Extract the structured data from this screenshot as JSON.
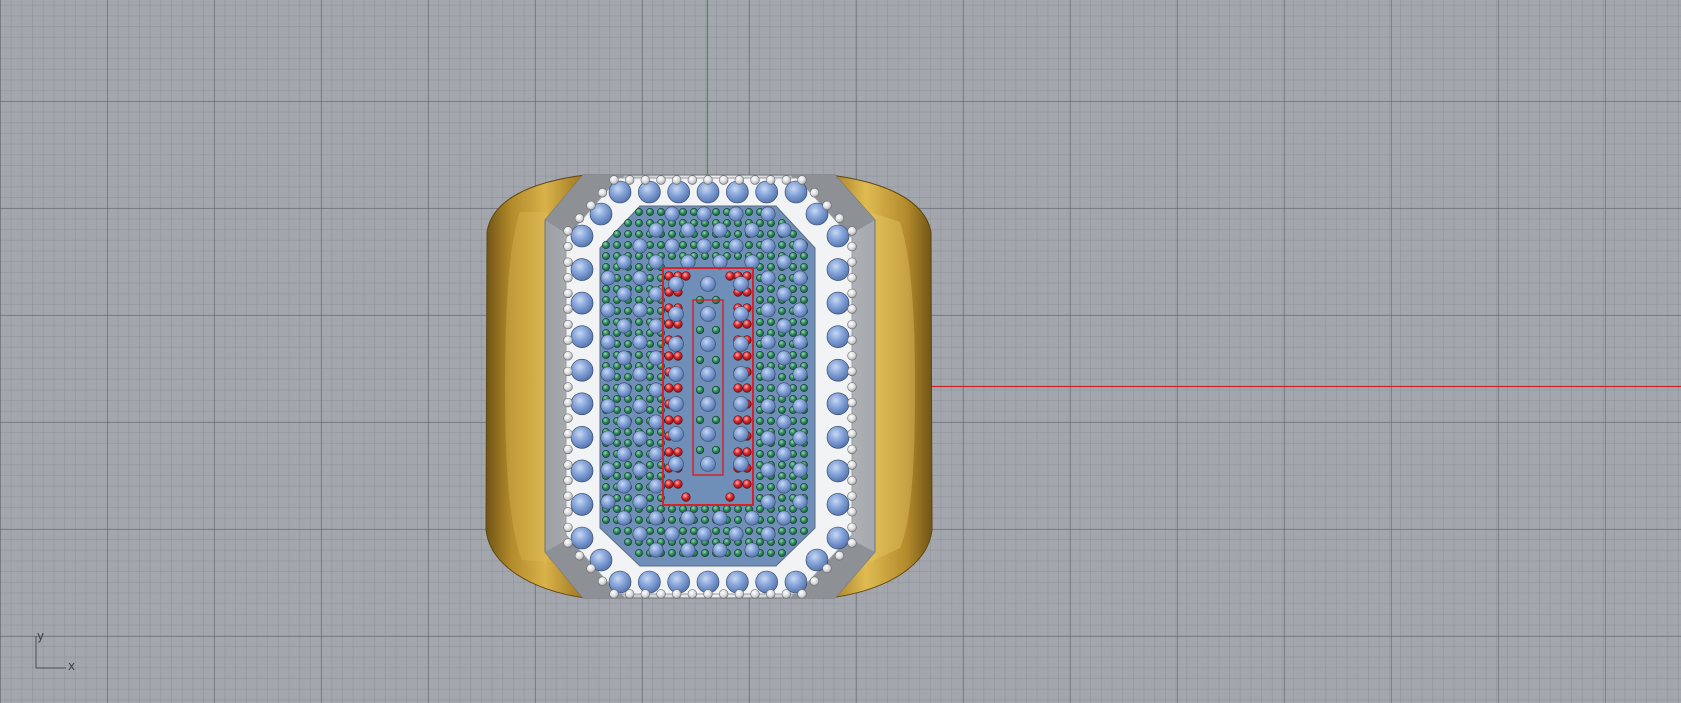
{
  "viewport": {
    "view_type": "top view",
    "background": "#a3a7ad",
    "grid_line_color": "#6b7078"
  },
  "axes": {
    "x_label": "x",
    "y_label": "y",
    "x_axis_color": "#c8262a",
    "y_axis_color": "#27a632"
  },
  "ring": {
    "band_color": "#c9a33a",
    "bezel_color": "#c9cccf",
    "stones": {
      "halo_color": "#7f9fd6",
      "accent_color": "#2e8a5e",
      "letter_color": "#d3242c",
      "bead_color": "#e6e7e8"
    }
  }
}
